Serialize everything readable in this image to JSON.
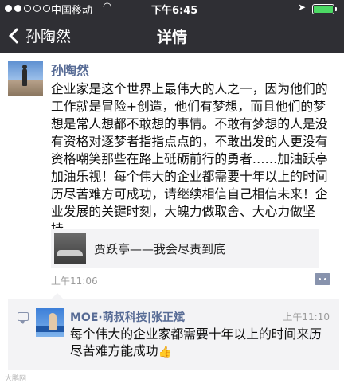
{
  "status_bar": {
    "carrier": "中国移动",
    "time": "下午6:45",
    "signal_filled": 2,
    "signal_total": 5
  },
  "nav": {
    "back_label": "孙陶然",
    "title": "详情"
  },
  "post": {
    "author": "孙陶然",
    "text": "企业家是这个世界上最伟大的人之一，因为他们的工作就是冒险+创造，他们有梦想，而且他们的梦想是常人想都不敢想的事情。不敢有梦想的人是没有资格对逐梦者指指点点的，不敢出发的人更没有资格嘲笑那些在路上砥砺前行的勇者……加油跃亭加油乐视！每个伟大的企业都需要十年以上的时间历尽苦难方可成功，请继续相信自己相信未来！企业发展的关键时刻，大魄力做取舍、大心力做坚持……",
    "link_title": "贾跃亭——我会尽责到底",
    "time": "上午11:06"
  },
  "comment": {
    "author": "MOE·萌叔科技|张正斌",
    "time": "上午11:10",
    "text": "每个伟大的企业家都需要十年以上的时间来历尽苦难方能成功",
    "emoji": "👍"
  },
  "watermark": "大鹏网",
  "colors": {
    "nav_bg": "#2f2f34",
    "link_blue": "#576b95",
    "comment_bg": "#f3f3f5",
    "battery": "#4cd964"
  },
  "icons": [
    "back-chevron-icon",
    "wifi-icon",
    "location-arrow-icon",
    "battery-icon",
    "comment-action-icon",
    "comment-bubble-icon"
  ]
}
